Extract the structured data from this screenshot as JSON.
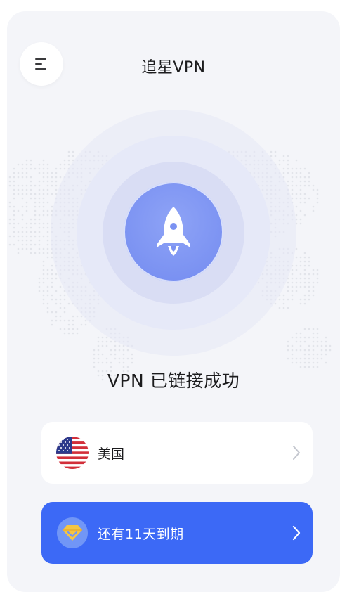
{
  "header": {
    "title": "追星VPN",
    "menu_icon": "menu-icon"
  },
  "connection": {
    "status_text": "VPN 已链接成功",
    "icon": "rocket-icon"
  },
  "server": {
    "country": "美国",
    "flag_icon": "us-flag-icon",
    "chevron_icon": "chevron-right-icon"
  },
  "subscription": {
    "text": "还有11天到期",
    "icon": "diamond-icon",
    "chevron_icon": "chevron-right-icon"
  },
  "colors": {
    "background": "#f4f5f9",
    "primary": "#3c69f6",
    "connect_button": "#7b92f2",
    "diamond": "#f5c542"
  }
}
